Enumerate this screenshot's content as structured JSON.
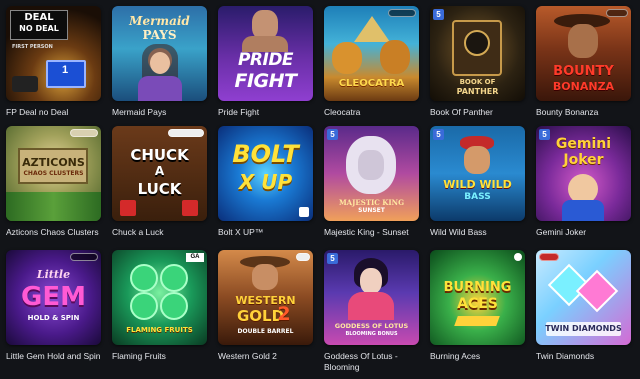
{
  "games": [
    {
      "title": "FP Deal no Deal",
      "logo": [
        "DEAL",
        "NO DEAL",
        "FIRST PERSON"
      ]
    },
    {
      "title": "Mermaid Pays",
      "logo": [
        "Mermaid",
        "PAYS"
      ]
    },
    {
      "title": "Pride Fight",
      "logo": [
        "PRIDE",
        "FIGHT"
      ]
    },
    {
      "title": "Cleocatra",
      "logo": [
        "CLEOCATRA"
      ]
    },
    {
      "title": "Book Of Panther",
      "logo": [
        "BOOK OF",
        "PANTHER"
      ]
    },
    {
      "title": "Bounty Bonanza",
      "logo": [
        "BOUNTY",
        "BONANZA"
      ]
    },
    {
      "title": "Azticons Chaos Clusters",
      "logo": [
        "AZTICONS",
        "CHAOS CLUSTERS"
      ]
    },
    {
      "title": "Chuck a Luck",
      "logo": [
        "CHUCK",
        "A",
        "LUCK"
      ]
    },
    {
      "title": "Bolt X UP™",
      "logo": [
        "BOLT",
        "X UP"
      ]
    },
    {
      "title": "Majestic King - Sunset",
      "logo": [
        "MAJESTIC KING",
        "SUNSET"
      ]
    },
    {
      "title": "Wild Wild Bass",
      "logo": [
        "WILD WILD",
        "BASS"
      ]
    },
    {
      "title": "Gemini Joker",
      "logo": [
        "Gemini",
        "Joker"
      ]
    },
    {
      "title": "Little Gem Hold and Spin",
      "logo": [
        "Little",
        "GEM",
        "HOLD & SPIN"
      ]
    },
    {
      "title": "Flaming Fruits",
      "logo": [
        "FLAMING FRUITS"
      ]
    },
    {
      "title": "Western Gold 2",
      "logo": [
        "WESTERN",
        "GOLD",
        "2",
        "DOUBLE BARREL"
      ]
    },
    {
      "title": "Goddess Of Lotus - Blooming",
      "logo": [
        "GODDESS OF LOTUS",
        "BLOOMING BONUS"
      ]
    },
    {
      "title": "Burning Aces",
      "logo": [
        "BURNING",
        "ACES"
      ]
    },
    {
      "title": "Twin Diamonds",
      "logo": [
        "TWIN DIAMONDS"
      ]
    }
  ]
}
